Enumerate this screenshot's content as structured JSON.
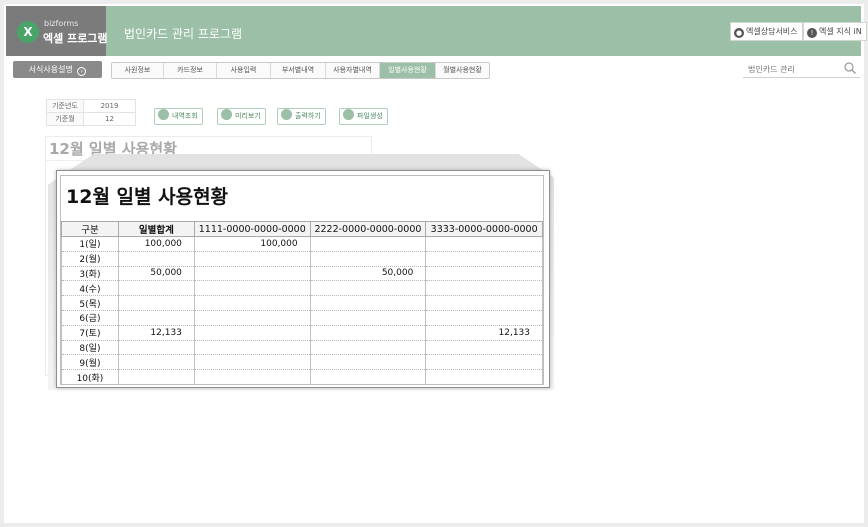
{
  "header": {
    "logo_sub": "bizforms",
    "logo_title": "엑셀 프로그램",
    "app_title": "법인카드 관리 프로그램",
    "btn_consult": "엑셀상담서비스",
    "btn_knowledge": "엑셀 지식 iN",
    "colors": {
      "header": "#9bbfa7",
      "logo_block": "#7b7b7b"
    }
  },
  "menu": {
    "guide_button": "서식사용설명",
    "tabs": [
      {
        "label": "사원정보"
      },
      {
        "label": "카드정보"
      },
      {
        "label": "사용입력"
      },
      {
        "label": "부서별내역"
      },
      {
        "label": "사용자별내역"
      },
      {
        "label": "일별사용현황",
        "active": true
      },
      {
        "label": "월별사용현황"
      }
    ]
  },
  "search": {
    "placeholder": "법인카드 관리"
  },
  "info": {
    "rows": [
      {
        "label": "기준년도",
        "value": "2019"
      },
      {
        "label": "기준월",
        "value": "12"
      }
    ]
  },
  "actions": {
    "view": "내역조회",
    "preview": "미리보기",
    "print": "출력하기",
    "file": "파일생성"
  },
  "background_sheet": {
    "title": "12월 일별 사용현황"
  },
  "sheet": {
    "title": "12월 일별 사용현황",
    "columns": [
      "구분",
      "일별합계",
      "1111-0000-0000-0000",
      "2222-0000-0000-0000",
      "3333-0000-0000-0000"
    ],
    "rows": [
      {
        "day": "1(일)",
        "total": "100,000",
        "c1": "100,000",
        "c2": "",
        "c3": ""
      },
      {
        "day": "2(월)",
        "total": "",
        "c1": "",
        "c2": "",
        "c3": ""
      },
      {
        "day": "3(화)",
        "total": "50,000",
        "c1": "",
        "c2": "50,000",
        "c3": ""
      },
      {
        "day": "4(수)",
        "total": "",
        "c1": "",
        "c2": "",
        "c3": ""
      },
      {
        "day": "5(목)",
        "total": "",
        "c1": "",
        "c2": "",
        "c3": ""
      },
      {
        "day": "6(금)",
        "total": "",
        "c1": "",
        "c2": "",
        "c3": ""
      },
      {
        "day": "7(토)",
        "total": "12,133",
        "c1": "",
        "c2": "",
        "c3": "12,133"
      },
      {
        "day": "8(일)",
        "total": "",
        "c1": "",
        "c2": "",
        "c3": ""
      },
      {
        "day": "9(월)",
        "total": "",
        "c1": "",
        "c2": "",
        "c3": ""
      },
      {
        "day": "10(화)",
        "total": "",
        "c1": "",
        "c2": "",
        "c3": ""
      }
    ]
  }
}
